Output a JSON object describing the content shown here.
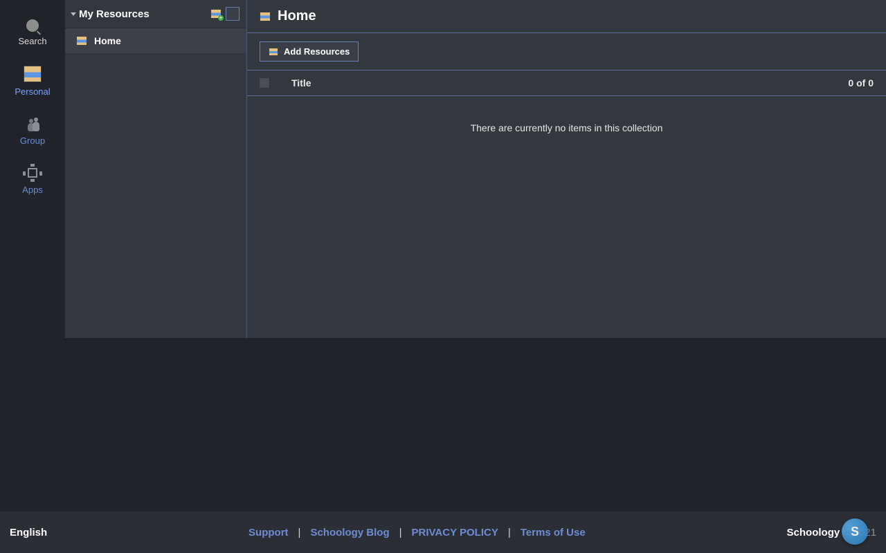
{
  "nav": {
    "search": "Search",
    "personal": "Personal",
    "group": "Group",
    "apps": "Apps"
  },
  "sidebar": {
    "title": "My Resources",
    "items": [
      {
        "label": "Home"
      }
    ]
  },
  "page": {
    "title": "Home",
    "add_resources_label": "Add Resources",
    "table": {
      "title_header": "Title",
      "count_text": "0 of 0"
    },
    "empty_message": "There are currently no items in this collection"
  },
  "footer": {
    "language": "English",
    "links": {
      "support": "Support",
      "blog": "Schoology Blog",
      "privacy": "PRIVACY POLICY",
      "terms": "Terms of Use"
    },
    "brand": "Schoology",
    "copyright_suffix": " © 2021",
    "floater_letter": "S"
  }
}
